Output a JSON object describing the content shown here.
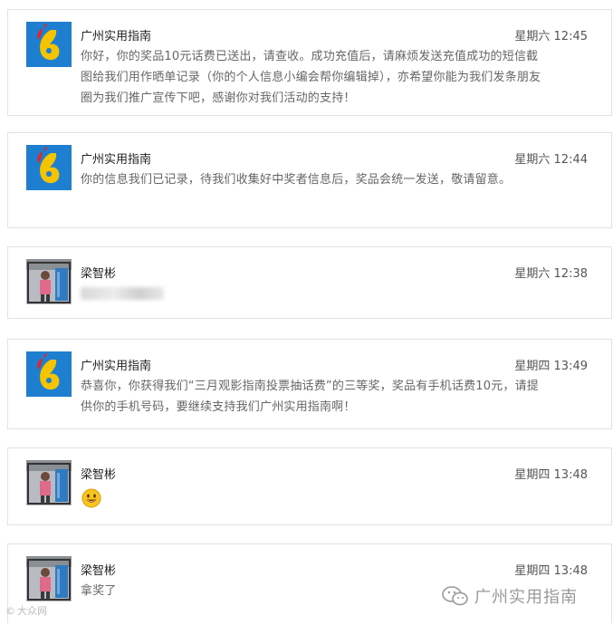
{
  "messages": [
    {
      "sender": "广州实用指南",
      "avatar": "brand-logo",
      "time": "星期六 12:45",
      "text": "你好，你的奖品10元话费已送出，请查收。成功充值后，请麻烦发送充值成功的短信截图给我们用作晒单记录（你的个人信息小编会帮你编辑掉），亦希望你能为我们发条朋友圈为我们推广宣传下吧，感谢你对我们活动的支持！"
    },
    {
      "sender": "广州实用指南",
      "avatar": "brand-logo",
      "time": "星期六 12:44",
      "text": "你的信息我们已记录，待我们收集好中奖者信息后，奖品会统一发送，敬请留意。"
    },
    {
      "sender": "梁智彬",
      "avatar": "user-photo",
      "time": "星期六 12:38",
      "text": ""
    },
    {
      "sender": "广州实用指南",
      "avatar": "brand-logo",
      "time": "星期四 13:49",
      "text": "恭喜你，你获得我们“三月观影指南投票抽话费”的三等奖，奖品有手机话费10元，请提供你的手机号码，要继续支持我们广州实用指南啊！"
    },
    {
      "sender": "梁智彬",
      "avatar": "user-photo",
      "time": "星期四 13:48",
      "text": "",
      "emoji": "smile-emoji"
    },
    {
      "sender": "梁智彬",
      "avatar": "user-photo",
      "time": "星期四 13:48",
      "text": "拿奖了"
    }
  ],
  "watermark": {
    "left": "大众网",
    "right": "广州实用指南"
  }
}
